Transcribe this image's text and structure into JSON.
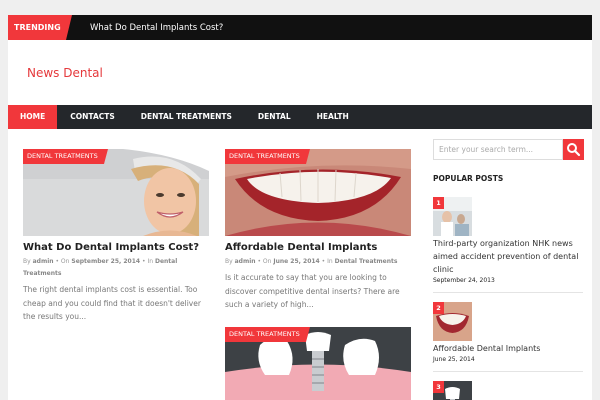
{
  "trending": {
    "label": "TRENDING",
    "headline": "What Do Dental Implants Cost?"
  },
  "site": {
    "title": "News Dental"
  },
  "nav": {
    "items": [
      "HOME",
      "CONTACTS",
      "DENTAL TREATMENTS",
      "DENTAL",
      "HEALTH"
    ]
  },
  "posts": [
    {
      "category": "DENTAL TREATMENTS",
      "title": "What Do Dental Implants Cost?",
      "meta_by": "By",
      "author": "admin",
      "meta_on": "On",
      "date": "September 25, 2014",
      "meta_in": "In",
      "category_link": "Dental Treatments",
      "excerpt": "The right dental implants cost is essential. Too cheap and you could find that it doesn't deliver the results you..."
    },
    {
      "category": "DENTAL TREATMENTS",
      "title": "Affordable Dental Implants",
      "meta_by": "By",
      "author": "admin",
      "meta_on": "On",
      "date": "June 25, 2014",
      "meta_in": "In",
      "category_link": "Dental Treatments",
      "excerpt": "Is it accurate to say that you are looking to discover competitive dental inserts? There are such a variety of high..."
    },
    {
      "category": "DENTAL TREATMENTS"
    }
  ],
  "sidebar": {
    "search_placeholder": "Enter your search term...",
    "popular_title": "POPULAR POSTS",
    "popular": [
      {
        "num": "1",
        "title": "Third-party organization NHK news aimed accident prevention of dental clinic",
        "date": "September 24, 2013"
      },
      {
        "num": "2",
        "title": "Affordable Dental Implants",
        "date": "June 25, 2014"
      },
      {
        "num": "3"
      }
    ]
  },
  "colors": {
    "accent": "#f1373b",
    "dark": "#24272b",
    "title_red": "#e5383b"
  }
}
